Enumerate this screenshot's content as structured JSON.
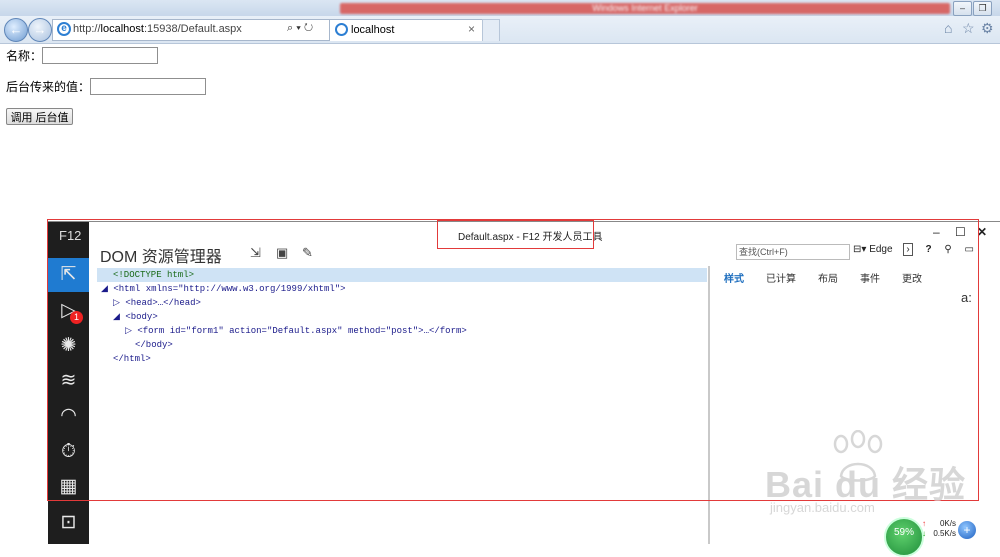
{
  "browser": {
    "window_title": "Windows Internet Explorer",
    "address": "http://localhost:15938/Default.aspx",
    "address_host": "localhost",
    "address_prefix": "http://",
    "address_suffix": ":15938/Default.aspx",
    "tab_label": "localhost",
    "tab_close": "×",
    "back_glyph": "←",
    "forward_glyph": "→",
    "search_glyph": "⌕",
    "refresh_glyph": "↻",
    "home_glyph": "⌂",
    "favorites_glyph": "☆",
    "tools_glyph": "⚙",
    "min_glyph": "–",
    "restore_glyph": "❐"
  },
  "page": {
    "name_label": "名称：",
    "back_label": "后台传来的值：",
    "name_value": "",
    "back_value": "",
    "call_button": "调用 后台值"
  },
  "devtools": {
    "f12_label": "F12",
    "window_title": "Default.aspx - F12 开发人员工具",
    "heading": "DOM 资源管理器",
    "search_placeholder": "查找(Ctrl+F)",
    "engine": "Edge",
    "badge_count": "1",
    "min": "–",
    "max": "☐",
    "close": "✕",
    "dom_lines": [
      "<!DOCTYPE html>",
      "<html xmlns=\"http://www.w3.org/1999/xhtml\">",
      "<head>…</head>",
      "<body>",
      "<form id=\"form1\" action=\"Default.aspx\" method=\"post\">…</form>",
      "</body>",
      "</html>"
    ],
    "right_tabs": [
      "样式",
      "已计算",
      "布局",
      "事件",
      "更改"
    ],
    "right_glyph": "a:"
  },
  "watermark": {
    "brand": "Bai du 经验",
    "url": "jingyan.baidu.com"
  },
  "widget": {
    "percent": "59%",
    "up": "0K/s",
    "down": "0.5K/s",
    "plus": "+"
  }
}
